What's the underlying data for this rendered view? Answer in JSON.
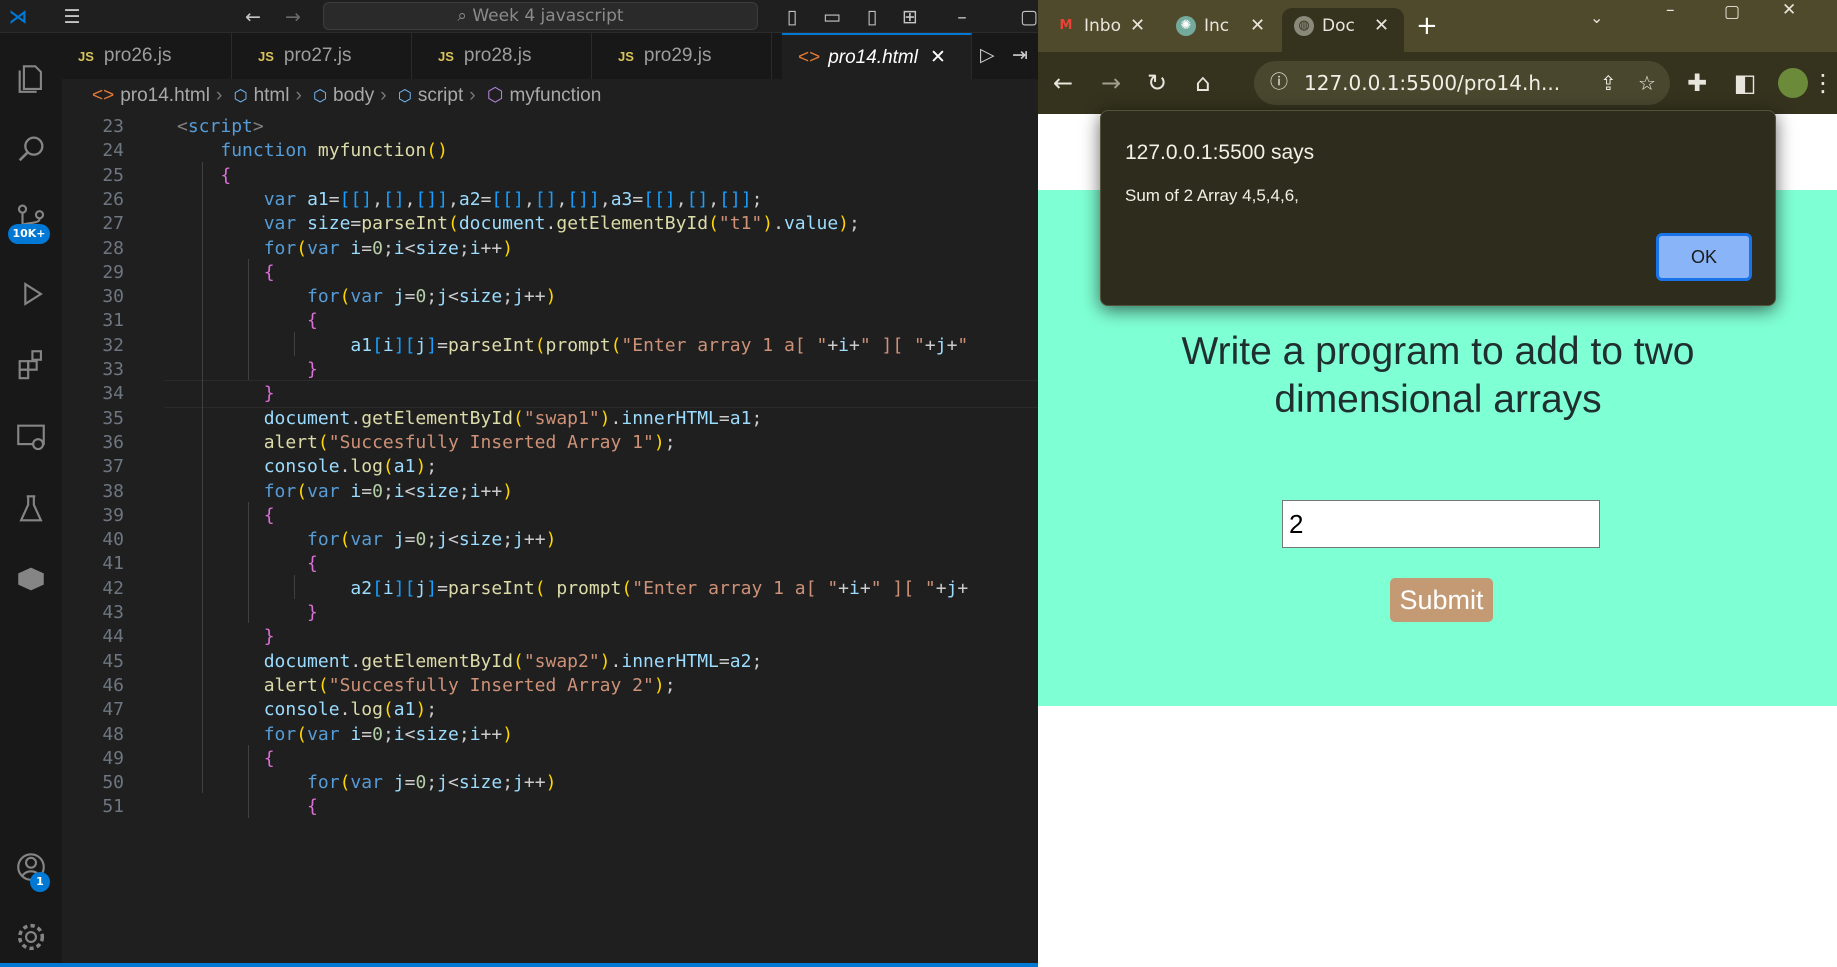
{
  "vscode": {
    "search_placeholder": "Week 4 javascript",
    "tabs": [
      {
        "label": "pro26.js",
        "badge": "JS"
      },
      {
        "label": "pro27.js",
        "badge": "JS"
      },
      {
        "label": "pro28.js",
        "badge": "JS"
      },
      {
        "label": "pro29.js",
        "badge": "JS"
      },
      {
        "label": "pro14.html",
        "badge": "<>"
      }
    ],
    "breadcrumb": [
      "pro14.html",
      "html",
      "body",
      "script",
      "myfunction"
    ],
    "activity_badges": {
      "source_control": "10K+",
      "accounts": "1"
    },
    "line_numbers": [
      "23",
      "24",
      "25",
      "26",
      "27",
      "28",
      "29",
      "30",
      "31",
      "32",
      "33",
      "34",
      "35",
      "36",
      "37",
      "38",
      "39",
      "40",
      "41",
      "42",
      "43",
      "44",
      "45",
      "46",
      "47",
      "48",
      "49",
      "50",
      "51"
    ],
    "code_lines": [
      "<script>",
      "    function myfunction()",
      "    {",
      "        var a1=[[],[],[]],a2=[[],[],[]],a3=[[],[],[]];",
      "        var size=parseInt(document.getElementById(\"t1\").value);",
      "        for(var i=0;i<size;i++)",
      "        {",
      "            for(var j=0;j<size;j++)",
      "            {",
      "                a1[i][j]=parseInt(prompt(\"Enter array 1 a[ \"+i+\" ][ \"+j+\"",
      "            }",
      "        }",
      "        document.getElementById(\"swap1\").innerHTML=a1;",
      "        alert(\"Succesfully Inserted Array 1\");",
      "        console.log(a1);",
      "        for(var i=0;i<size;i++)",
      "        {",
      "            for(var j=0;j<size;j++)",
      "            {",
      "                a2[i][j]=parseInt( prompt(\"Enter array 1 a[ \"+i+\" ][ \"+j+",
      "            }",
      "        }",
      "        document.getElementById(\"swap2\").innerHTML=a2;",
      "        alert(\"Succesfully Inserted Array 2\");",
      "        console.log(a1);",
      "        for(var i=0;i<size;i++)",
      "        {",
      "            for(var j=0;j<size;j++)",
      "            {"
    ]
  },
  "browser": {
    "tabs": [
      {
        "label": "Inbo",
        "icon": "gmail-icon"
      },
      {
        "label": "Inc",
        "icon": "chatgpt-icon"
      },
      {
        "label": "Doc",
        "icon": "globe-icon"
      }
    ],
    "url": "127.0.0.1:5500/pro14.h...",
    "alert": {
      "title": "127.0.0.1:5500 says",
      "message": "Sum of 2 Array  4,5,4,6,",
      "ok_label": "OK"
    },
    "page": {
      "heading": "Write a program to add to two dimensional arrays",
      "input_value": "2",
      "submit_label": "Submit"
    }
  }
}
